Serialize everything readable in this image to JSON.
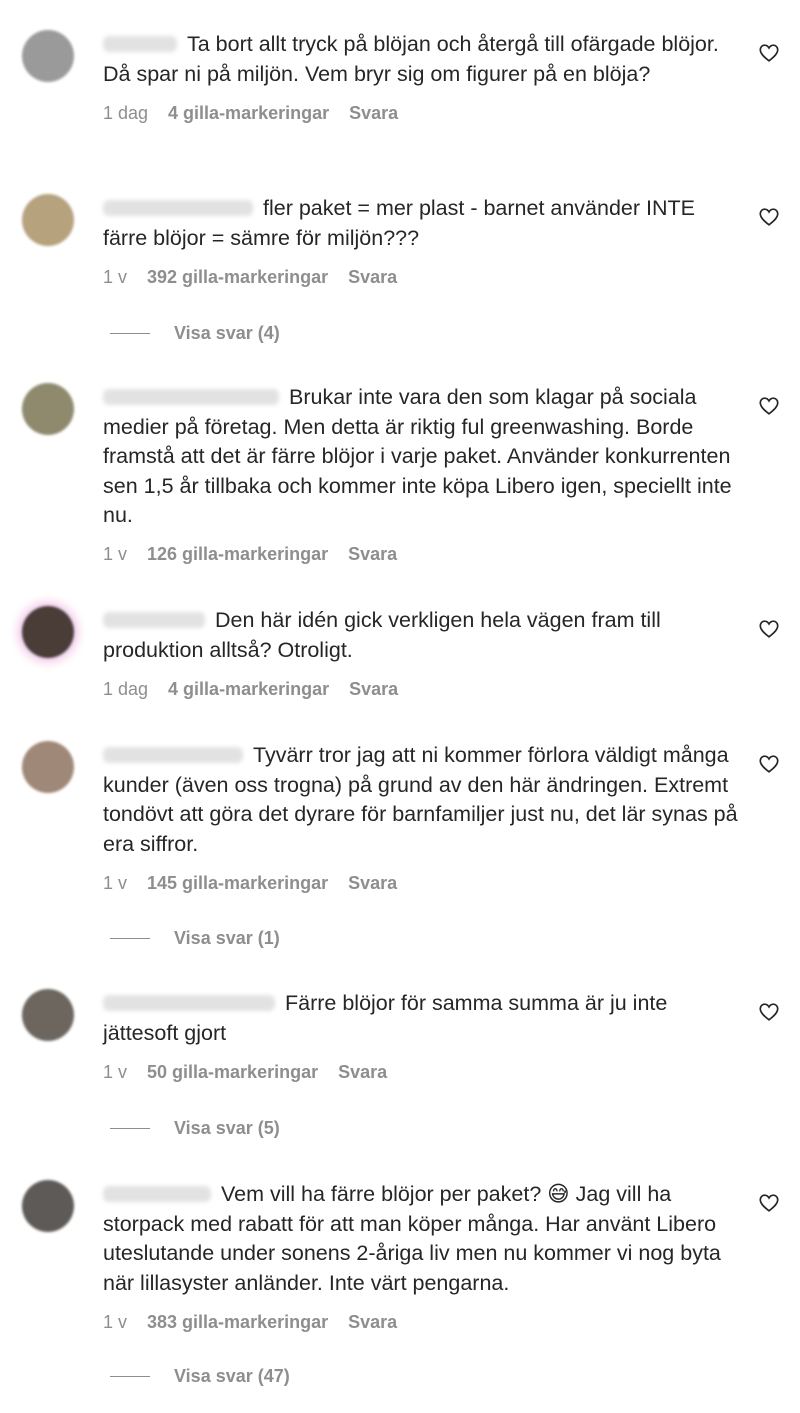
{
  "comments": [
    {
      "text": "Ta bort allt tryck på blöjan och återgå till ofärgade blöjor. Då spar ni på miljön. Vem bryr sig om figurer på en blöja?",
      "time": "1 dag",
      "likes": "4 gilla-markeringar",
      "reply": "Svara",
      "avatar_color": "#9a9a9a"
    },
    {
      "text": "fler paket = mer plast - barnet använder INTE färre blöjor = sämre för miljön???",
      "time": "1 v",
      "likes": "392 gilla-markeringar",
      "reply": "Svara",
      "view_replies": "Visa svar (4)",
      "avatar_color": "#b7a27e"
    },
    {
      "text": "Brukar inte vara den som klagar på sociala medier på företag. Men detta är riktig ful greenwashing. Borde framstå att det är färre blöjor i varje paket. Använder konkurrenten sen 1,5 år tillbaka och kommer inte köpa Libero igen, speciellt inte nu.",
      "time": "1 v",
      "likes": "126 gilla-markeringar",
      "reply": "Svara",
      "avatar_color": "#8f8a6e"
    },
    {
      "text": "Den här idén gick verkligen hela vägen fram till produktion alltså? Otroligt.",
      "time": "1 dag",
      "likes": "4 gilla-markeringar",
      "reply": "Svara",
      "avatar_color": "#4a3c36"
    },
    {
      "text": "Tyvärr tror jag att ni kommer förlora väldigt många kunder (även oss trogna) på grund av den här ändringen. Extremt tondövt att göra det dyrare för barnfamiljer just nu, det lär synas på era siffror.",
      "time": "1 v",
      "likes": "145 gilla-markeringar",
      "reply": "Svara",
      "view_replies": "Visa svar (1)",
      "avatar_color": "#a08878"
    },
    {
      "text": "Färre blöjor för samma summa är ju inte jättesoft gjort",
      "time": "1 v",
      "likes": "50 gilla-markeringar",
      "reply": "Svara",
      "view_replies": "Visa svar (5)",
      "avatar_color": "#6c665f"
    },
    {
      "text": "Vem vill ha färre blöjor per paket? 😅 Jag vill ha storpack med rabatt för att man köper många. Har använt Libero uteslutande under sonens 2-åriga liv men nu kommer vi nog byta när lillasyster anländer. Inte värt pengarna.",
      "time": "1 v",
      "likes": "383 gilla-markeringar",
      "reply": "Svara",
      "view_replies": "Visa svar (47)",
      "avatar_color": "#5e5a57"
    }
  ]
}
